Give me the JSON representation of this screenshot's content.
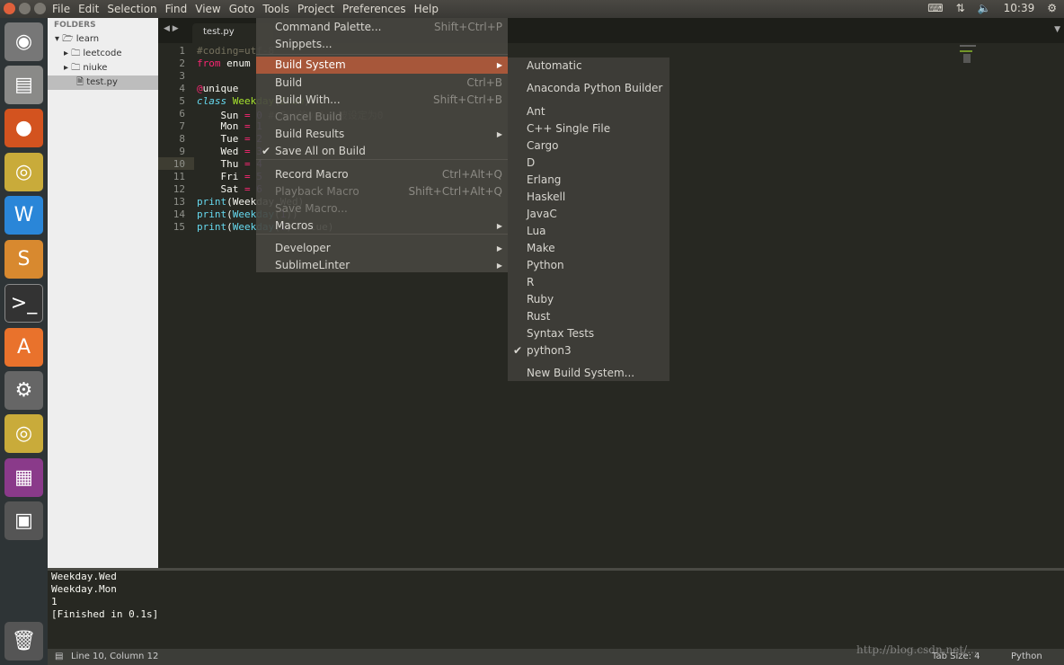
{
  "topbar": {
    "menu": [
      "File",
      "Edit",
      "Selection",
      "Find",
      "View",
      "Goto",
      "Tools",
      "Project",
      "Preferences",
      "Help"
    ],
    "time": "10:39"
  },
  "sidebar": {
    "header": "FOLDERS",
    "items": [
      {
        "label": "learn",
        "type": "folder-open"
      },
      {
        "label": "leetcode",
        "type": "folder"
      },
      {
        "label": "niuke",
        "type": "folder"
      },
      {
        "label": "test.py",
        "type": "file",
        "selected": true
      }
    ]
  },
  "editor": {
    "tab": "test.py",
    "current_line": 10,
    "lines": [
      "#coding=utf-8",
      "from enum import Enum, unique",
      "",
      "@unique",
      "class Weekday(Enum):",
      "    Sun = 0 # Sun的value被设定为0",
      "    Mon = 1",
      "    Tue = 2",
      "    Wed = 3",
      "    Thu = 4",
      "    Fri = 5",
      "    Sat = 6",
      "print(Weekday.Wed)",
      "print(Weekday(1))",
      "print(Weekday(1).value)"
    ]
  },
  "tools_menu": {
    "items": [
      {
        "label": "Command Palette...",
        "shortcut": "Shift+Ctrl+P"
      },
      {
        "label": "Snippets..."
      },
      {
        "label": "Build System",
        "submenu": true,
        "selected": true
      },
      {
        "label": "Build",
        "shortcut": "Ctrl+B"
      },
      {
        "label": "Build With...",
        "shortcut": "Shift+Ctrl+B"
      },
      {
        "label": "Cancel Build",
        "disabled": true
      },
      {
        "label": "Build Results",
        "submenu": true
      },
      {
        "label": "Save All on Build",
        "checked": true
      },
      {
        "label": "Record Macro",
        "shortcut": "Ctrl+Alt+Q"
      },
      {
        "label": "Playback Macro",
        "shortcut": "Shift+Ctrl+Alt+Q",
        "disabled": true
      },
      {
        "label": "Save Macro...",
        "disabled": true
      },
      {
        "label": "Macros",
        "submenu": true
      },
      {
        "label": "Developer",
        "submenu": true
      },
      {
        "label": "SublimeLinter",
        "submenu": true
      }
    ]
  },
  "build_system_menu": {
    "items": [
      "Automatic",
      "Anaconda Python Builder",
      "Ant",
      "C++ Single File",
      "Cargo",
      "D",
      "Erlang",
      "Haskell",
      "JavaC",
      "Lua",
      "Make",
      "Python",
      "R",
      "Ruby",
      "Rust",
      "Syntax Tests",
      "python3",
      "New Build System..."
    ],
    "checked": "python3"
  },
  "output": {
    "lines": [
      "Weekday.Wed",
      "Weekday.Mon",
      "1",
      "[Finished in 0.1s]"
    ]
  },
  "status": {
    "position": "Line 10, Column 12",
    "tab_size": "Tab Size: 4",
    "syntax": "Python"
  },
  "watermark": "http://blog.csdn.net/..."
}
